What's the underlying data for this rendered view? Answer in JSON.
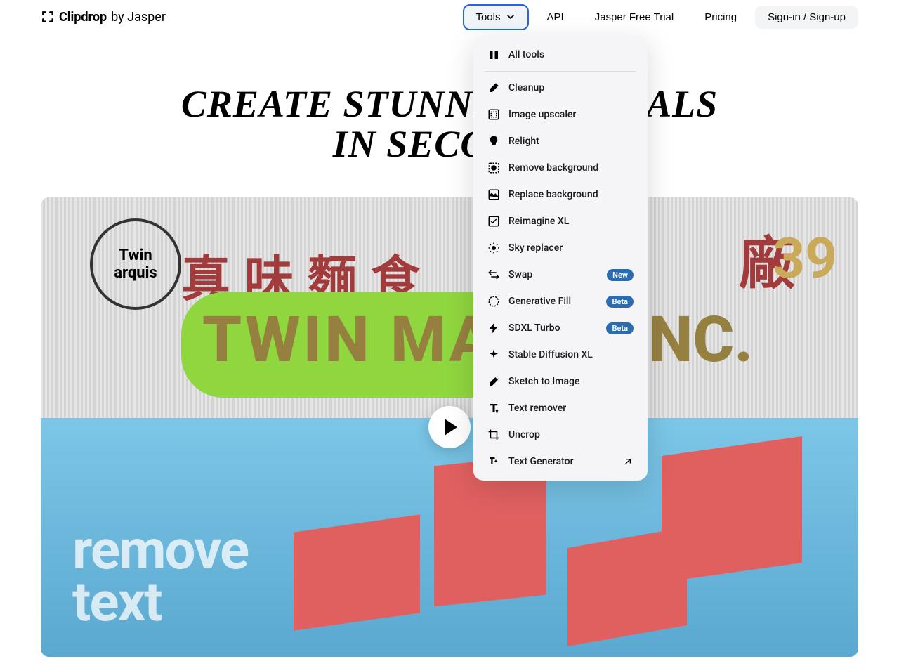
{
  "header": {
    "logo_name": "Clipdrop",
    "logo_by": "by Jasper"
  },
  "nav": {
    "tools": "Tools",
    "api": "API",
    "trial": "Jasper Free Trial",
    "pricing": "Pricing",
    "signin": "Sign-in / Sign-up"
  },
  "hero": {
    "line1": "CREATE STUNNING VISUALS",
    "line2": "IN SECONDS"
  },
  "video": {
    "overlay_line1": "remove",
    "overlay_line2": "text",
    "chinese": "真味麵食",
    "twin_text": "TWIN MAR",
    "nc_text": "NC.",
    "circle_top": "Twin",
    "circle_bottom": "arquis",
    "factory": "廠",
    "num": "39"
  },
  "dropdown": {
    "all_tools": "All tools",
    "items": [
      {
        "label": "Cleanup",
        "badge": null
      },
      {
        "label": "Image upscaler",
        "badge": null
      },
      {
        "label": "Relight",
        "badge": null
      },
      {
        "label": "Remove background",
        "badge": null
      },
      {
        "label": "Replace background",
        "badge": null
      },
      {
        "label": "Reimagine XL",
        "badge": null
      },
      {
        "label": "Sky replacer",
        "badge": null
      },
      {
        "label": "Swap",
        "badge": "New"
      },
      {
        "label": "Generative Fill",
        "badge": "Beta"
      },
      {
        "label": "SDXL Turbo",
        "badge": "Beta"
      },
      {
        "label": "Stable Diffusion XL",
        "badge": null
      },
      {
        "label": "Sketch to Image",
        "badge": null
      },
      {
        "label": "Text remover",
        "badge": null
      },
      {
        "label": "Uncrop",
        "badge": null
      },
      {
        "label": "Text Generator",
        "badge": null,
        "external": true
      }
    ]
  }
}
